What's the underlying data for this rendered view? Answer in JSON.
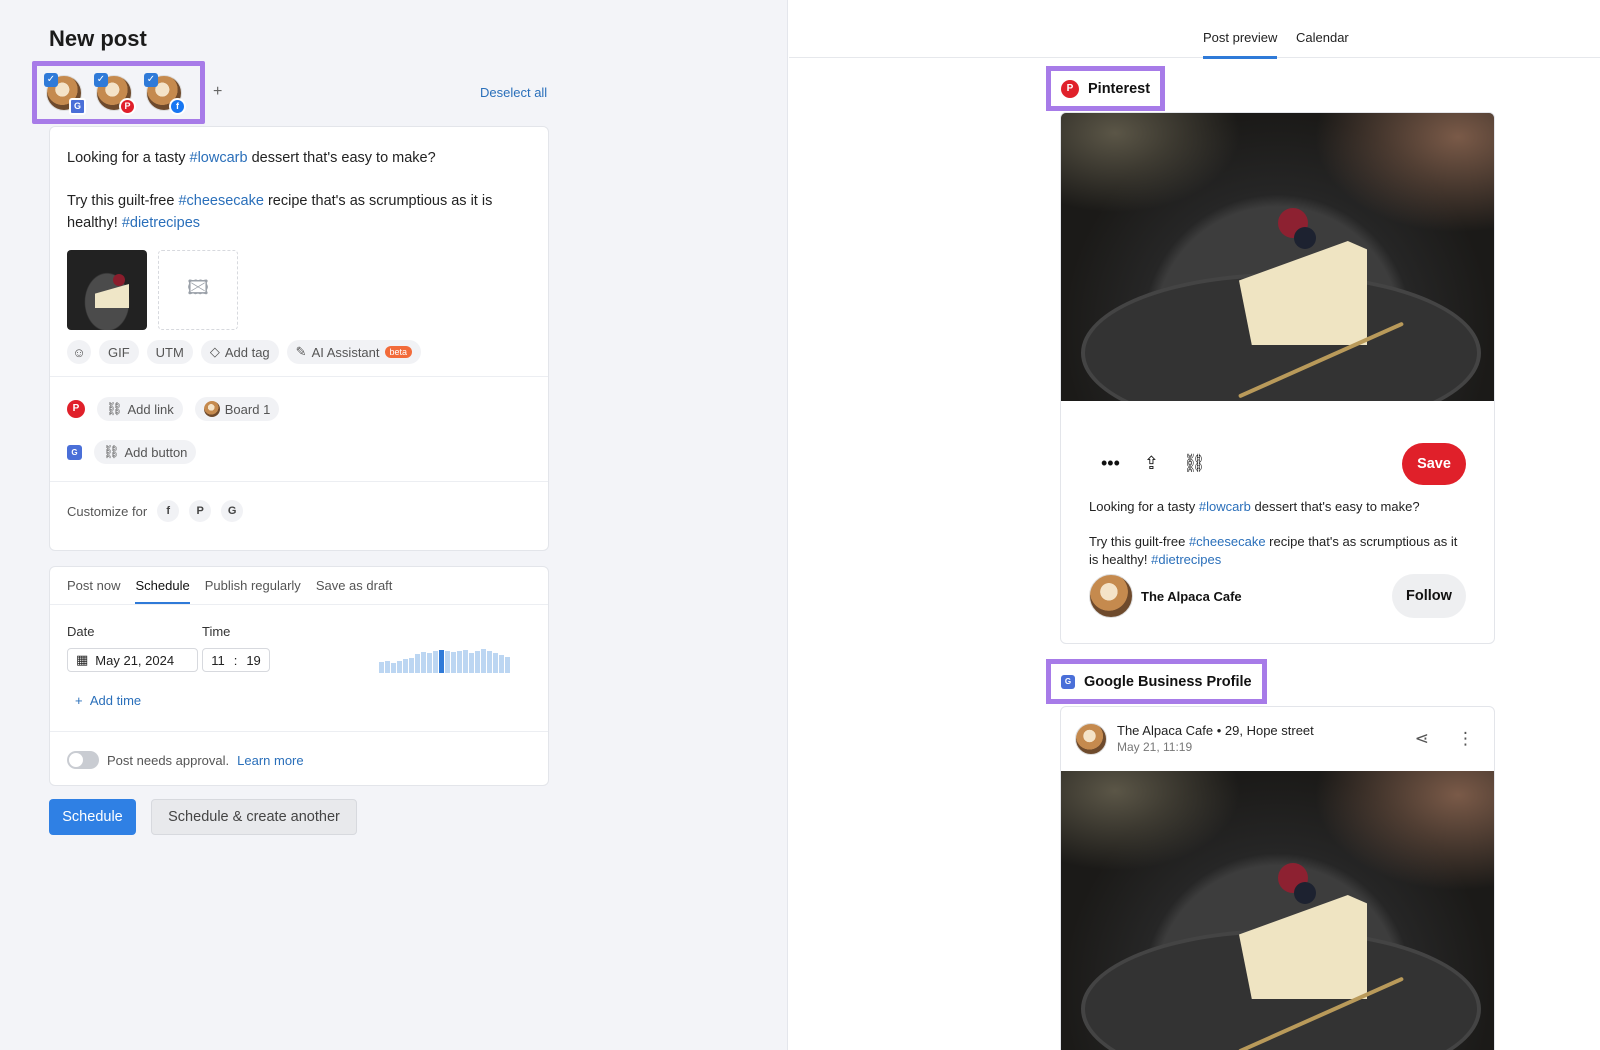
{
  "composer": {
    "page_title": "New post",
    "accounts": [
      {
        "network": "google-business-profile",
        "checked": true,
        "network_icon": "google-business-profile-icon"
      },
      {
        "network": "pinterest",
        "checked": true,
        "network_icon": "pinterest-icon"
      },
      {
        "network": "facebook",
        "checked": true,
        "network_icon": "facebook-icon"
      }
    ],
    "add_account": "+",
    "deselect_all": "Deselect all",
    "text": {
      "line1_prefix": "Looking for a tasty ",
      "line1_tag": "#lowcarb",
      "line1_suffix": " dessert that's easy to make?",
      "line2_prefix": "Try this guilt-free ",
      "line2_tag1": "#cheesecake",
      "line2_middle": " recipe that's as scrumptious as it is healthy! ",
      "line2_tag2": "#dietrecipes"
    },
    "tools": {
      "gif": "GIF",
      "utm": "UTM",
      "add_tag": "Add tag",
      "ai_assistant": "AI Assistant",
      "beta": "beta"
    },
    "pinterest_options": {
      "add_link": "Add link",
      "board": "Board 1"
    },
    "gbp_options": {
      "add_button": "Add button"
    },
    "customize_for": "Customize for"
  },
  "schedule": {
    "tabs": [
      "Post now",
      "Schedule",
      "Publish regularly",
      "Save as draft"
    ],
    "active_tab": "Schedule",
    "date_label": "Date",
    "time_label": "Time",
    "date_value": "May 21, 2024",
    "time_hour": "11",
    "time_sep": ":",
    "time_minute": "19",
    "add_time": "Add time",
    "approval_text": "Post needs approval.",
    "learn_more": "Learn more",
    "approval_enabled": false
  },
  "buttons": {
    "schedule": "Schedule",
    "schedule_and_create": "Schedule & create another"
  },
  "preview": {
    "tabs": [
      "Post preview",
      "Calendar"
    ],
    "active_tab": "Post preview",
    "pinterest": {
      "header": "Pinterest",
      "save": "Save",
      "text_line1_prefix": "Looking for a tasty ",
      "text_line1_tag": "#lowcarb",
      "text_line1_suffix": " dessert that's easy to make?",
      "text_line2_prefix": "Try this guilt-free ",
      "text_line2_tag1": "#cheesecake",
      "text_line2_middle": " recipe that's as scrumptious as it is healthy! ",
      "text_line2_tag2": "#dietrecipes",
      "author": "The Alpaca Cafe",
      "follow": "Follow"
    },
    "gbp": {
      "header": "Google Business Profile",
      "business_line": "The Alpaca Cafe • 29, Hope street",
      "date_line": "May 21, 11:19"
    }
  },
  "colors": {
    "accent": "#2f7ad8",
    "highlight_border": "#a77be8",
    "pinterest_red": "#e0202a",
    "link": "#2a6fba"
  }
}
